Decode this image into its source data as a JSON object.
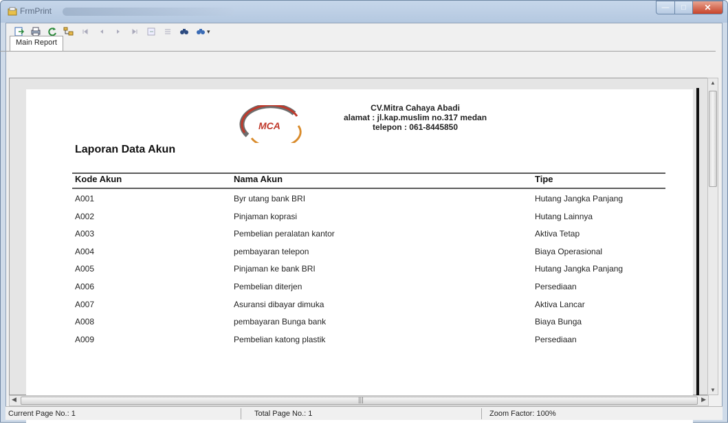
{
  "window": {
    "title": "FrmPrint",
    "minimize_glyph": "—",
    "maximize_glyph": "□",
    "close_glyph": "✕"
  },
  "toolbar": {
    "buttons": [
      {
        "icon": "export-icon",
        "glyph": "⎙"
      },
      {
        "icon": "print-icon",
        "glyph": "⎙"
      },
      {
        "icon": "refresh-icon",
        "glyph": "↻"
      },
      {
        "icon": "group-tree-icon",
        "glyph": "▤"
      },
      {
        "icon": "first-page-icon",
        "glyph": "⏮"
      },
      {
        "icon": "previous-page-icon",
        "glyph": "◀"
      },
      {
        "icon": "next-page-icon",
        "glyph": "▶"
      },
      {
        "icon": "last-page-icon",
        "glyph": "⏭"
      },
      {
        "icon": "goto-page-icon",
        "glyph": "▣"
      },
      {
        "icon": "stop-icon",
        "glyph": "■"
      },
      {
        "icon": "search-icon",
        "glyph": "⚲"
      },
      {
        "icon": "zoom-icon",
        "glyph": "⚲"
      }
    ],
    "zoom_dropdown_glyph": "▾"
  },
  "tab": {
    "label": "Main Report"
  },
  "report": {
    "company_name": "CV.Mitra Cahaya Abadi",
    "company_address": "alamat : jl.kap.muslim no.317 medan",
    "company_phone": "telepon : 061-8445850",
    "logo_text": "MCA",
    "title": "Laporan Data Akun",
    "columns": [
      "Kode Akun",
      "Nama Akun",
      "Tipe"
    ],
    "rows": [
      [
        "A001",
        "Byr utang bank BRI",
        "Hutang Jangka Panjang"
      ],
      [
        "A002",
        "Pinjaman koprasi",
        "Hutang Lainnya"
      ],
      [
        "A003",
        "Pembelian peralatan kantor",
        "Aktiva Tetap"
      ],
      [
        "A004",
        "pembayaran telepon",
        "Biaya Operasional"
      ],
      [
        "A005",
        "Pinjaman ke bank BRI",
        "Hutang Jangka Panjang"
      ],
      [
        "A006",
        "Pembelian diterjen",
        "Persediaan"
      ],
      [
        "A007",
        "Asuransi dibayar dimuka",
        "Aktiva Lancar"
      ],
      [
        "A008",
        "pembayaran Bunga bank",
        "Biaya Bunga"
      ],
      [
        "A009",
        "Pembelian katong plastik",
        "Persediaan"
      ]
    ]
  },
  "statusbar": {
    "current_page": "Current Page No.: 1",
    "total_page": "Total Page No.: 1",
    "zoom": "Zoom Factor: 100%"
  },
  "colors": {
    "logo_red": "#c0392b",
    "logo_gray": "#6d6d6d",
    "logo_orange": "#d98b2b"
  }
}
